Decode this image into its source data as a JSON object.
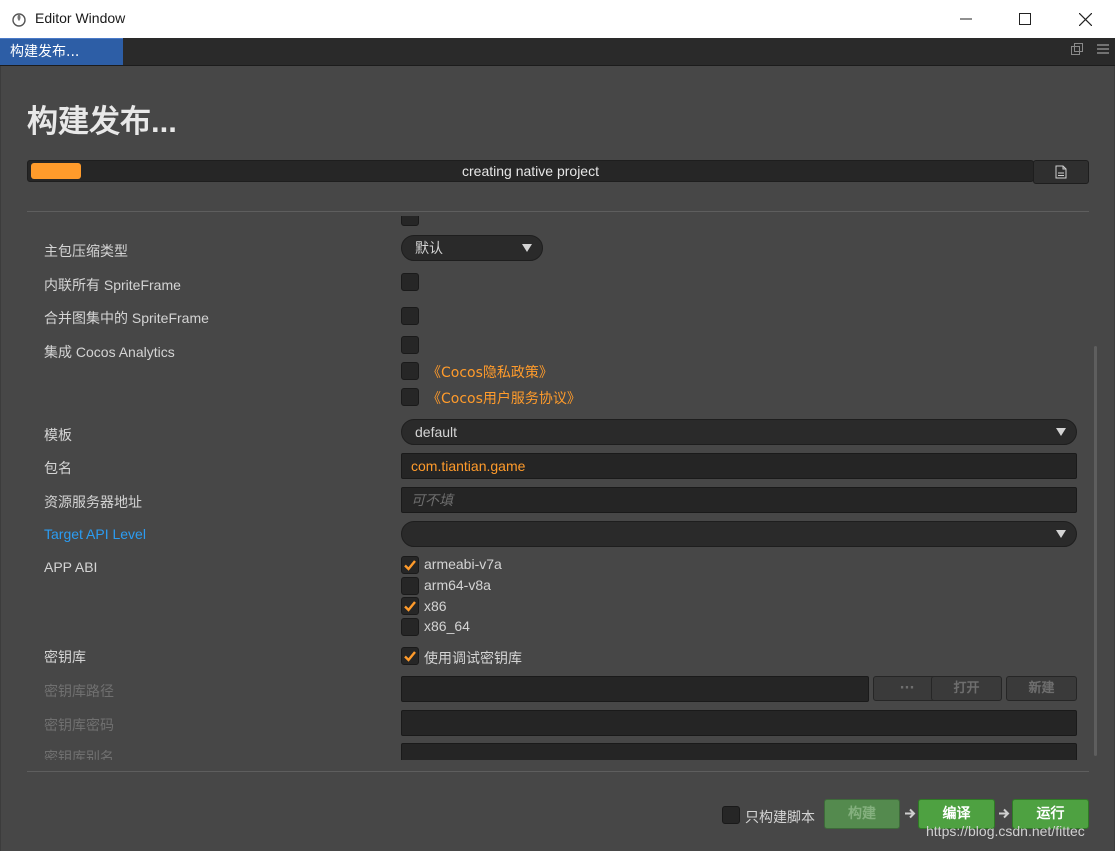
{
  "window": {
    "title": "Editor Window",
    "minimize_icon": "minimize-icon",
    "maximize_icon": "maximize-icon",
    "close_icon": "close-icon"
  },
  "tabs": [
    {
      "label": "构建发布..."
    }
  ],
  "panel": {
    "heading": "构建发布...",
    "progress": {
      "text": "creating native project",
      "fraction": 0.05,
      "color": "#ff9b2b"
    }
  },
  "form": {
    "compression": {
      "label": "主包压缩类型",
      "value": "默认"
    },
    "inline_spriteframe": {
      "label": "内联所有 SpriteFrame",
      "checked": false
    },
    "merge_spriteframe": {
      "label": "合并图集中的 SpriteFrame",
      "checked": false
    },
    "cocos_analytics": {
      "label": "集成 Cocos Analytics",
      "checked": false,
      "privacy_link": "《Cocos隐私政策》",
      "service_link": "《Cocos用户服务协议》"
    },
    "template": {
      "label": "模板",
      "value": "default"
    },
    "package_name": {
      "label": "包名",
      "value": "com.tiantian.game"
    },
    "server": {
      "label": "资源服务器地址",
      "placeholder": "可不填"
    },
    "target_api": {
      "label": "Target API Level",
      "value": ""
    },
    "app_abi": {
      "label": "APP ABI",
      "options": [
        {
          "label": "armeabi-v7a",
          "checked": true
        },
        {
          "label": "arm64-v8a",
          "checked": false
        },
        {
          "label": "x86",
          "checked": true
        },
        {
          "label": "x86_64",
          "checked": false
        }
      ]
    },
    "keystore": {
      "label": "密钥库",
      "debug_label": "使用调试密钥库",
      "debug_checked": true
    },
    "keystore_path": {
      "label": "密钥库路径",
      "browse": "···",
      "open": "打开",
      "new": "新建"
    },
    "keystore_password": {
      "label": "密钥库密码"
    },
    "keystore_alias": {
      "label": "密钥库别名"
    }
  },
  "footer": {
    "build_script_only": {
      "label": "只构建脚本",
      "checked": false
    },
    "build": "构建",
    "compile": "编译",
    "run": "运行"
  },
  "watermark": "https://blog.csdn.net/fittec",
  "colors": {
    "accent": "#ff9b2b",
    "tab_active": "#2d5ea6",
    "green_button": "#4ea141",
    "link_blue": "#2b9cf2"
  }
}
